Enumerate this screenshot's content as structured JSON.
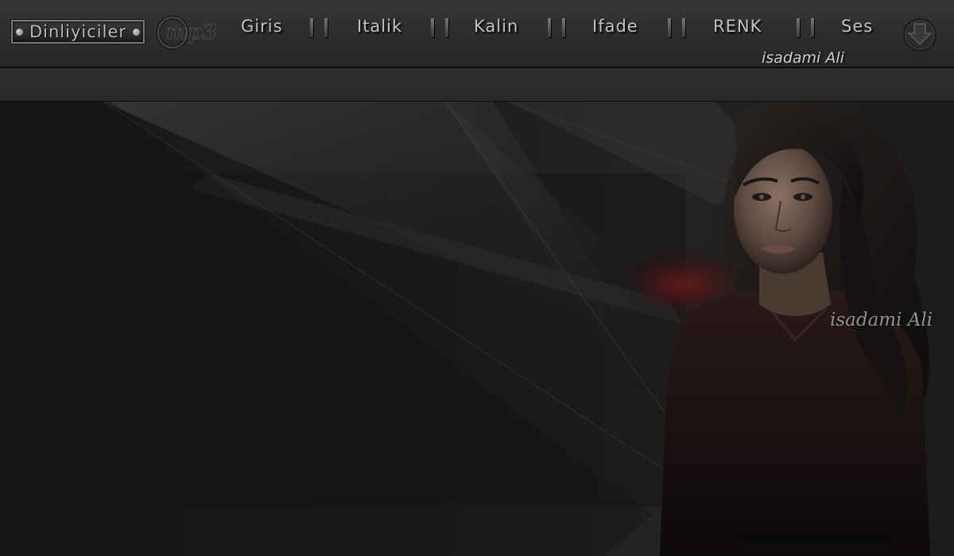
{
  "toolbar": {
    "listeners_label": "Dinliyiciler",
    "mp3_logo_text": "mp3",
    "nav_items": [
      "Giris",
      "Italik",
      "Kalin",
      "Ifade",
      "RENK",
      "Ses"
    ],
    "author": "isadami Ali"
  },
  "watermark": {
    "text": "isadami Ali"
  },
  "icons": {
    "mp3": "mp3-logo-icon",
    "download": "download-arrow-icon",
    "separator": "double-bar-separator-icon"
  },
  "colors": {
    "toolbar_bg": "#2e2e2e",
    "text": "#c4c4c4",
    "stage_bg": "#1b1b1b",
    "accent_red": "#5a1414"
  }
}
